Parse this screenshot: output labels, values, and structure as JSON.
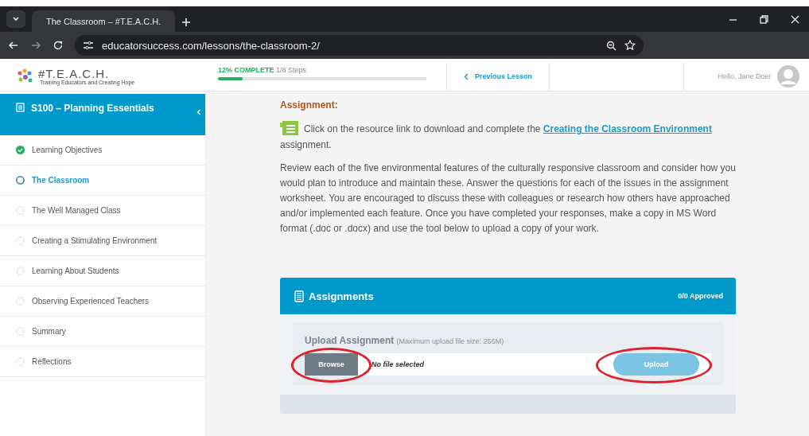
{
  "browser": {
    "tab_title": "The Classroom – #T.E.A.C.H.",
    "url": "educatorsuccess.com/lessons/the-classroom-2/"
  },
  "header": {
    "logo": "#T.E.A.C.H.",
    "tagline": "Training Educators and Creating Hope",
    "progress": {
      "label": "12% COMPLETE",
      "steps": "1/8 Steps",
      "level": 0.12
    },
    "previous_lesson": "Previous Lesson",
    "greeting": "Hello, Jane Doe!"
  },
  "sidebar": {
    "title": "S100 – Planning Essentials",
    "items": [
      {
        "label": "Learning Objectives",
        "kind": "completed",
        "selected": false
      },
      {
        "label": "The Classroom",
        "kind": "current",
        "selected": true
      },
      {
        "label": "The Well Managed Class",
        "kind": "pending",
        "selected": false
      },
      {
        "label": "Creating a Stimulating Environment",
        "kind": "pending",
        "selected": false
      },
      {
        "label": "Learning About Students",
        "kind": "pending",
        "selected": false
      },
      {
        "label": "Observing Experienced Teachers",
        "kind": "pending",
        "selected": false
      },
      {
        "label": "Summary",
        "kind": "pending",
        "selected": false
      },
      {
        "label": "Reflections",
        "kind": "pending",
        "selected": false
      }
    ]
  },
  "content": {
    "heading": "Assignment:",
    "intro_before": "Click on the resource link to download and complete the",
    "link": "Creating the Classroom Environment",
    "intro_after": "assignment.",
    "paragraph": "Review each of the five environmental features of the culturally responsive classroom and consider how you would plan to introduce and maintain these. Answer the questions for each of the issues in the assignment worksheet. You are encouraged to discuss these with colleagues or research how others have approached and/or implemented each feature. Once you have completed your responses, make a copy in MS Word format (.doc or .docx) and use the tool below to upload a copy of your work."
  },
  "assignments": {
    "title": "Assignments",
    "approved": "0/0 Approved",
    "upload_title": "Upload Assignment",
    "upload_note": "(Maximum upload file size: 256M)",
    "browse_button": {
      "label": "Browse",
      "circled": true
    },
    "file_status": "No file selected",
    "upload_button": {
      "label": "Upload",
      "circled": true,
      "disabled": true
    }
  }
}
